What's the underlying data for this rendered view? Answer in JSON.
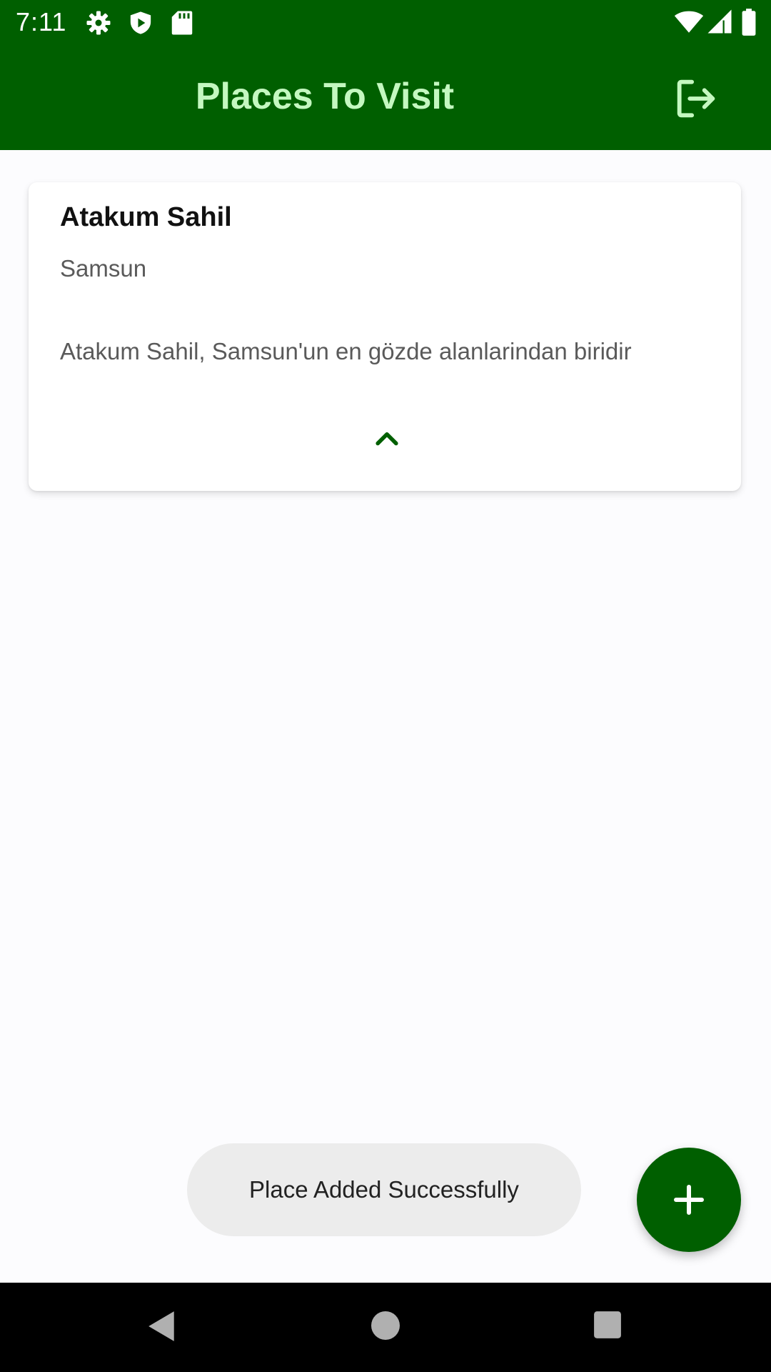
{
  "status_bar": {
    "time": "7:11",
    "left_icons": [
      "gear-icon",
      "play-shield-icon",
      "sd-card-icon"
    ],
    "right_icons": [
      "wifi-icon",
      "signal-icon",
      "battery-icon"
    ]
  },
  "app_bar": {
    "title": "Places To Visit",
    "action_icon": "logout-icon"
  },
  "places": [
    {
      "name": "Atakum Sahil",
      "city": "Samsun",
      "description": "Atakum Sahil, Samsun'un en gözde alanlarindan biridir",
      "expanded": true,
      "toggle_icon": "chevron-up-icon"
    }
  ],
  "toast": {
    "message": "Place Added Successfully"
  },
  "fab": {
    "icon": "plus-icon"
  },
  "nav_bar": {
    "icons": [
      "back-icon",
      "home-icon",
      "recents-icon"
    ]
  },
  "colors": {
    "primary": "#005f00",
    "title_text": "#c4f8c0",
    "background": "#fcfcfe",
    "toast_background": "#ececec"
  }
}
